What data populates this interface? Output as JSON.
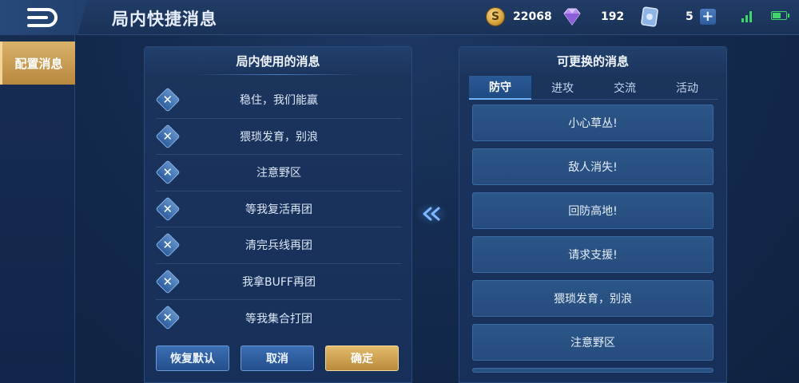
{
  "header": {
    "title": "局内快捷消息",
    "gold": "22068",
    "diamonds": "192",
    "cards": "5"
  },
  "sidebar": {
    "items": [
      {
        "label": "配置消息"
      }
    ]
  },
  "left_panel": {
    "title": "局内使用的消息",
    "messages": [
      "稳住，我们能赢",
      "猥琐发育，别浪",
      "注意野区",
      "等我复活再团",
      "清完兵线再团",
      "我拿BUFF再团",
      "等我集合打团"
    ],
    "buttons": {
      "restore": "恢复默认",
      "cancel": "取消",
      "confirm": "确定"
    }
  },
  "right_panel": {
    "title": "可更换的消息",
    "tabs": [
      "防守",
      "进攻",
      "交流",
      "活动"
    ],
    "active_tab": "防守",
    "options": [
      "小心草丛!",
      "敌人消失!",
      "回防高地!",
      "请求支援!",
      "猥琐发育，别浪",
      "注意野区"
    ]
  },
  "colors": {
    "accent_gold": "#d9b26a",
    "panel_bg": "#1b345c",
    "button_blue": "#3b6eb2",
    "signal_green": "#3ed66b"
  },
  "icons": [
    "back-icon",
    "gold-coin-icon",
    "diamond-icon",
    "card-icon",
    "plus-icon",
    "signal-icon",
    "battery-icon",
    "remove-icon",
    "double-chevron-left-icon"
  ]
}
